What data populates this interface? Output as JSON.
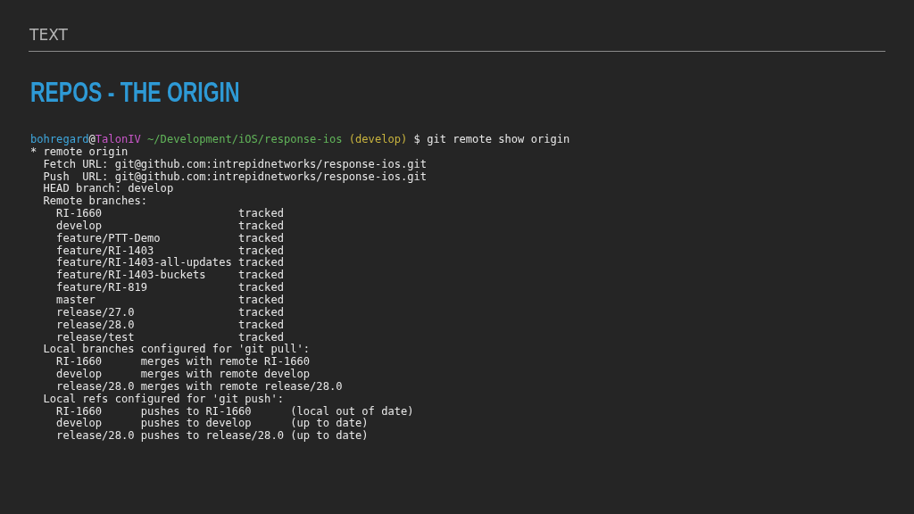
{
  "section_label": "TEXT",
  "title": "REPOS - THE ORIGIN",
  "terminal": {
    "prompt": [
      {
        "kind": "user",
        "text": "bohregard"
      },
      {
        "kind": "plain",
        "text": "@"
      },
      {
        "kind": "host",
        "text": "TalonIV"
      },
      {
        "kind": "path",
        "text": " ~/Development/iOS/response-ios"
      },
      {
        "kind": "branch",
        "text": " (develop)"
      },
      {
        "kind": "plain",
        "text": " $ git remote show origin"
      }
    ],
    "output": [
      "* remote origin",
      "  Fetch URL: git@github.com:intrepidnetworks/response-ios.git",
      "  Push  URL: git@github.com:intrepidnetworks/response-ios.git",
      "  HEAD branch: develop",
      "  Remote branches:",
      "    RI-1660                     tracked",
      "    develop                     tracked",
      "    feature/PTT-Demo            tracked",
      "    feature/RI-1403             tracked",
      "    feature/RI-1403-all-updates tracked",
      "    feature/RI-1403-buckets     tracked",
      "    feature/RI-819              tracked",
      "    master                      tracked",
      "    release/27.0                tracked",
      "    release/28.0                tracked",
      "    release/test                tracked",
      "  Local branches configured for 'git pull':",
      "    RI-1660      merges with remote RI-1660",
      "    develop      merges with remote develop",
      "    release/28.0 merges with remote release/28.0",
      "  Local refs configured for 'git push':",
      "    RI-1660      pushes to RI-1660      (local out of date)",
      "    develop      pushes to develop      (up to date)",
      "    release/28.0 pushes to release/28.0 (up to date)"
    ]
  }
}
